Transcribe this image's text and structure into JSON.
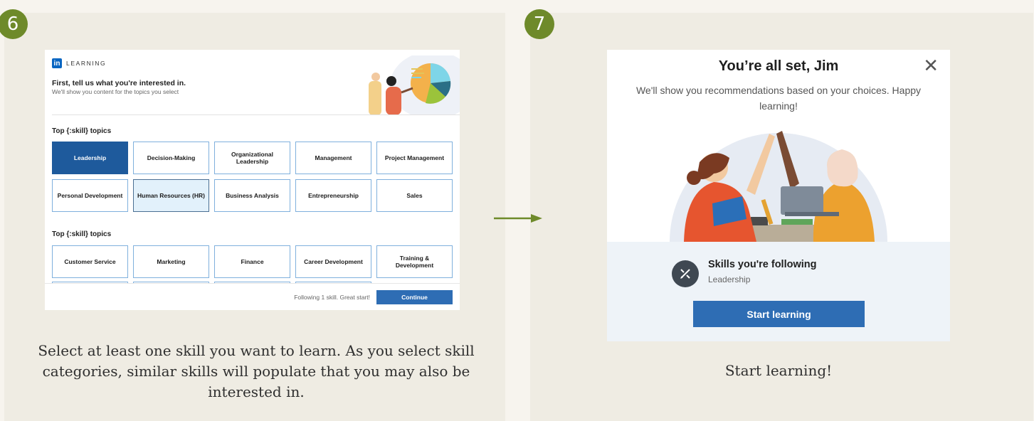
{
  "steps": {
    "left_number": "6",
    "right_number": "7"
  },
  "captions": {
    "left": "Select at least one skill you want to learn. As you select skill categories, similar skills will populate that you may also be interested in.",
    "right": "Start learning!"
  },
  "onboarding": {
    "logo_label": "LEARNING",
    "title": "First, tell us what you're interested in.",
    "subtitle": "We'll show you content for the topics you select",
    "section1_title": "Top {:skill} topics",
    "section2_title": "Top {:skill} topics",
    "row1": [
      "Leadership",
      "Decision-Making",
      "Organizational Leadership",
      "Management",
      "Project Management"
    ],
    "row2": [
      "Personal Development",
      "Human Resources (HR)",
      "Business Analysis",
      "Entrepreneurship",
      "Sales"
    ],
    "row3": [
      "Customer Service",
      "Marketing",
      "Finance",
      "Career Development",
      "Training & Development"
    ],
    "selected_skill": "Leadership",
    "footer_status": "Following 1 skill. Great start!",
    "continue_label": "Continue"
  },
  "confirmation": {
    "title": "You’re all set, Jim",
    "subtitle": "We'll show you recommendations based on your choices. Happy learning!",
    "skills_heading": "Skills you're following",
    "skill_name": "Leadership",
    "start_label": "Start learning"
  },
  "colors": {
    "badge": "#6e8a2a",
    "arrow": "#6e8a2a",
    "primary_blue": "#2e6db4",
    "panel_bg": "#efece3"
  },
  "icons": {
    "close": "close-icon",
    "skills": "skills-pencil-ruler-icon",
    "logo": "linkedin-in-icon"
  }
}
